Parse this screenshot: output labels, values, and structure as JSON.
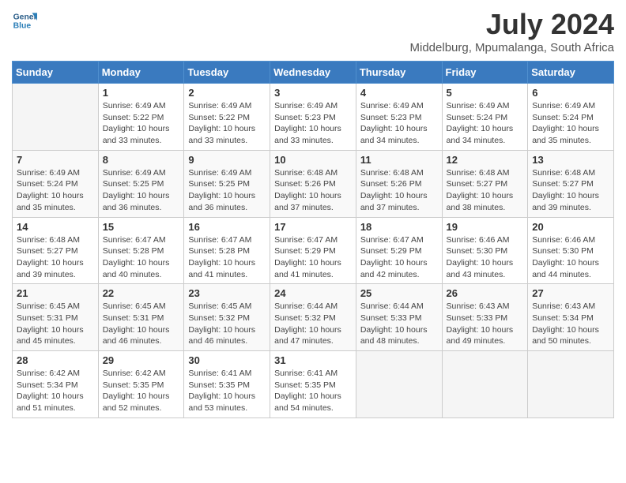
{
  "header": {
    "logo_general": "General",
    "logo_blue": "Blue",
    "title": "July 2024",
    "subtitle": "Middelburg, Mpumalanga, South Africa"
  },
  "weekdays": [
    "Sunday",
    "Monday",
    "Tuesday",
    "Wednesday",
    "Thursday",
    "Friday",
    "Saturday"
  ],
  "weeks": [
    [
      {
        "day": "",
        "sunrise": "",
        "sunset": "",
        "daylight": ""
      },
      {
        "day": "1",
        "sunrise": "Sunrise: 6:49 AM",
        "sunset": "Sunset: 5:22 PM",
        "daylight": "Daylight: 10 hours and 33 minutes."
      },
      {
        "day": "2",
        "sunrise": "Sunrise: 6:49 AM",
        "sunset": "Sunset: 5:22 PM",
        "daylight": "Daylight: 10 hours and 33 minutes."
      },
      {
        "day": "3",
        "sunrise": "Sunrise: 6:49 AM",
        "sunset": "Sunset: 5:23 PM",
        "daylight": "Daylight: 10 hours and 33 minutes."
      },
      {
        "day": "4",
        "sunrise": "Sunrise: 6:49 AM",
        "sunset": "Sunset: 5:23 PM",
        "daylight": "Daylight: 10 hours and 34 minutes."
      },
      {
        "day": "5",
        "sunrise": "Sunrise: 6:49 AM",
        "sunset": "Sunset: 5:24 PM",
        "daylight": "Daylight: 10 hours and 34 minutes."
      },
      {
        "day": "6",
        "sunrise": "Sunrise: 6:49 AM",
        "sunset": "Sunset: 5:24 PM",
        "daylight": "Daylight: 10 hours and 35 minutes."
      }
    ],
    [
      {
        "day": "7",
        "sunrise": "Sunrise: 6:49 AM",
        "sunset": "Sunset: 5:24 PM",
        "daylight": "Daylight: 10 hours and 35 minutes."
      },
      {
        "day": "8",
        "sunrise": "Sunrise: 6:49 AM",
        "sunset": "Sunset: 5:25 PM",
        "daylight": "Daylight: 10 hours and 36 minutes."
      },
      {
        "day": "9",
        "sunrise": "Sunrise: 6:49 AM",
        "sunset": "Sunset: 5:25 PM",
        "daylight": "Daylight: 10 hours and 36 minutes."
      },
      {
        "day": "10",
        "sunrise": "Sunrise: 6:48 AM",
        "sunset": "Sunset: 5:26 PM",
        "daylight": "Daylight: 10 hours and 37 minutes."
      },
      {
        "day": "11",
        "sunrise": "Sunrise: 6:48 AM",
        "sunset": "Sunset: 5:26 PM",
        "daylight": "Daylight: 10 hours and 37 minutes."
      },
      {
        "day": "12",
        "sunrise": "Sunrise: 6:48 AM",
        "sunset": "Sunset: 5:27 PM",
        "daylight": "Daylight: 10 hours and 38 minutes."
      },
      {
        "day": "13",
        "sunrise": "Sunrise: 6:48 AM",
        "sunset": "Sunset: 5:27 PM",
        "daylight": "Daylight: 10 hours and 39 minutes."
      }
    ],
    [
      {
        "day": "14",
        "sunrise": "Sunrise: 6:48 AM",
        "sunset": "Sunset: 5:27 PM",
        "daylight": "Daylight: 10 hours and 39 minutes."
      },
      {
        "day": "15",
        "sunrise": "Sunrise: 6:47 AM",
        "sunset": "Sunset: 5:28 PM",
        "daylight": "Daylight: 10 hours and 40 minutes."
      },
      {
        "day": "16",
        "sunrise": "Sunrise: 6:47 AM",
        "sunset": "Sunset: 5:28 PM",
        "daylight": "Daylight: 10 hours and 41 minutes."
      },
      {
        "day": "17",
        "sunrise": "Sunrise: 6:47 AM",
        "sunset": "Sunset: 5:29 PM",
        "daylight": "Daylight: 10 hours and 41 minutes."
      },
      {
        "day": "18",
        "sunrise": "Sunrise: 6:47 AM",
        "sunset": "Sunset: 5:29 PM",
        "daylight": "Daylight: 10 hours and 42 minutes."
      },
      {
        "day": "19",
        "sunrise": "Sunrise: 6:46 AM",
        "sunset": "Sunset: 5:30 PM",
        "daylight": "Daylight: 10 hours and 43 minutes."
      },
      {
        "day": "20",
        "sunrise": "Sunrise: 6:46 AM",
        "sunset": "Sunset: 5:30 PM",
        "daylight": "Daylight: 10 hours and 44 minutes."
      }
    ],
    [
      {
        "day": "21",
        "sunrise": "Sunrise: 6:45 AM",
        "sunset": "Sunset: 5:31 PM",
        "daylight": "Daylight: 10 hours and 45 minutes."
      },
      {
        "day": "22",
        "sunrise": "Sunrise: 6:45 AM",
        "sunset": "Sunset: 5:31 PM",
        "daylight": "Daylight: 10 hours and 46 minutes."
      },
      {
        "day": "23",
        "sunrise": "Sunrise: 6:45 AM",
        "sunset": "Sunset: 5:32 PM",
        "daylight": "Daylight: 10 hours and 46 minutes."
      },
      {
        "day": "24",
        "sunrise": "Sunrise: 6:44 AM",
        "sunset": "Sunset: 5:32 PM",
        "daylight": "Daylight: 10 hours and 47 minutes."
      },
      {
        "day": "25",
        "sunrise": "Sunrise: 6:44 AM",
        "sunset": "Sunset: 5:33 PM",
        "daylight": "Daylight: 10 hours and 48 minutes."
      },
      {
        "day": "26",
        "sunrise": "Sunrise: 6:43 AM",
        "sunset": "Sunset: 5:33 PM",
        "daylight": "Daylight: 10 hours and 49 minutes."
      },
      {
        "day": "27",
        "sunrise": "Sunrise: 6:43 AM",
        "sunset": "Sunset: 5:34 PM",
        "daylight": "Daylight: 10 hours and 50 minutes."
      }
    ],
    [
      {
        "day": "28",
        "sunrise": "Sunrise: 6:42 AM",
        "sunset": "Sunset: 5:34 PM",
        "daylight": "Daylight: 10 hours and 51 minutes."
      },
      {
        "day": "29",
        "sunrise": "Sunrise: 6:42 AM",
        "sunset": "Sunset: 5:35 PM",
        "daylight": "Daylight: 10 hours and 52 minutes."
      },
      {
        "day": "30",
        "sunrise": "Sunrise: 6:41 AM",
        "sunset": "Sunset: 5:35 PM",
        "daylight": "Daylight: 10 hours and 53 minutes."
      },
      {
        "day": "31",
        "sunrise": "Sunrise: 6:41 AM",
        "sunset": "Sunset: 5:35 PM",
        "daylight": "Daylight: 10 hours and 54 minutes."
      },
      {
        "day": "",
        "sunrise": "",
        "sunset": "",
        "daylight": ""
      },
      {
        "day": "",
        "sunrise": "",
        "sunset": "",
        "daylight": ""
      },
      {
        "day": "",
        "sunrise": "",
        "sunset": "",
        "daylight": ""
      }
    ]
  ]
}
